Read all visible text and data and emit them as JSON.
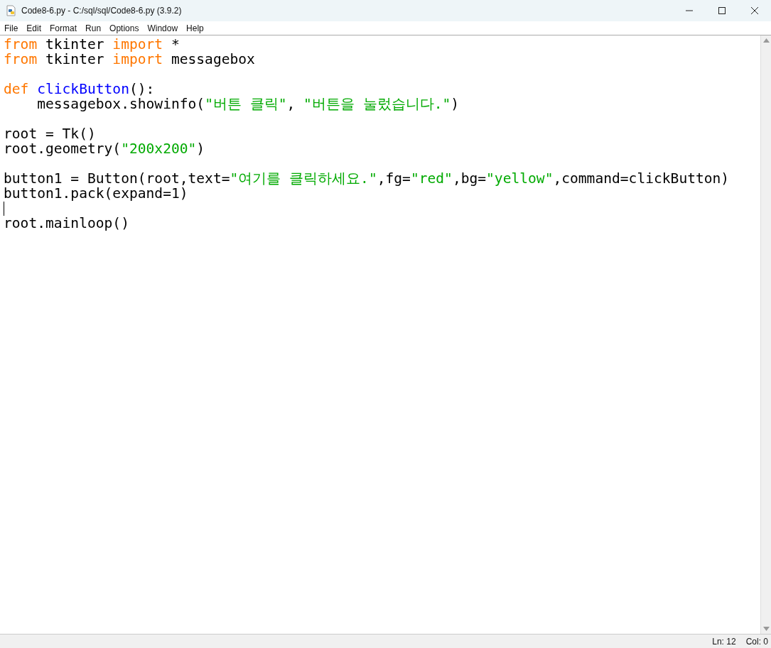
{
  "window": {
    "title": "Code8-6.py - C:/sql/sql/Code8-6.py (3.9.2)"
  },
  "menu": [
    "File",
    "Edit",
    "Format",
    "Run",
    "Options",
    "Window",
    "Help"
  ],
  "editor": {
    "lines": [
      {
        "kind": "code",
        "cursor": false,
        "tokens": [
          {
            "text": "from",
            "kind": "keyword"
          },
          {
            "text": " tkinter ",
            "kind": "plain"
          },
          {
            "text": "import",
            "kind": "keyword"
          },
          {
            "text": " *",
            "kind": "plain"
          }
        ]
      },
      {
        "kind": "code",
        "cursor": false,
        "tokens": [
          {
            "text": "from",
            "kind": "keyword"
          },
          {
            "text": " tkinter ",
            "kind": "plain"
          },
          {
            "text": "import",
            "kind": "keyword"
          },
          {
            "text": " messagebox",
            "kind": "plain"
          }
        ]
      },
      {
        "kind": "blank",
        "cursor": false
      },
      {
        "kind": "code",
        "cursor": false,
        "tokens": [
          {
            "text": "def ",
            "kind": "keyword"
          },
          {
            "text": "clickButton",
            "kind": "definition"
          },
          {
            "text": "():",
            "kind": "plain"
          }
        ]
      },
      {
        "kind": "code",
        "cursor": false,
        "tokens": [
          {
            "text": "    messagebox.showinfo(",
            "kind": "plain"
          },
          {
            "text": "\"버튼 클릭\"",
            "kind": "string"
          },
          {
            "text": ", ",
            "kind": "plain"
          },
          {
            "text": "\"버튼을 눌렀습니다.\"",
            "kind": "string"
          },
          {
            "text": ")",
            "kind": "plain"
          }
        ]
      },
      {
        "kind": "blank",
        "cursor": false
      },
      {
        "kind": "code",
        "cursor": false,
        "tokens": [
          {
            "text": "root = Tk()",
            "kind": "plain"
          }
        ]
      },
      {
        "kind": "code",
        "cursor": false,
        "tokens": [
          {
            "text": "root.geometry(",
            "kind": "plain"
          },
          {
            "text": "\"200x200\"",
            "kind": "string"
          },
          {
            "text": ")",
            "kind": "plain"
          }
        ]
      },
      {
        "kind": "blank",
        "cursor": false
      },
      {
        "kind": "code",
        "cursor": false,
        "tokens": [
          {
            "text": "button1 = Button(root,text=",
            "kind": "plain"
          },
          {
            "text": "\"여기를 클릭하세요.\"",
            "kind": "string"
          },
          {
            "text": ",fg=",
            "kind": "plain"
          },
          {
            "text": "\"red\"",
            "kind": "string"
          },
          {
            "text": ",bg=",
            "kind": "plain"
          },
          {
            "text": "\"yellow\"",
            "kind": "string"
          },
          {
            "text": ",command=clickButton)",
            "kind": "plain"
          }
        ]
      },
      {
        "kind": "code",
        "cursor": false,
        "tokens": [
          {
            "text": "button1.pack(expand=1)",
            "kind": "plain"
          }
        ]
      },
      {
        "kind": "blank",
        "cursor": true
      },
      {
        "kind": "code",
        "cursor": false,
        "tokens": [
          {
            "text": "root.mainloop()",
            "kind": "plain"
          }
        ]
      }
    ]
  },
  "status_bar": {
    "line": "Ln: 12",
    "column": "Col: 0"
  }
}
